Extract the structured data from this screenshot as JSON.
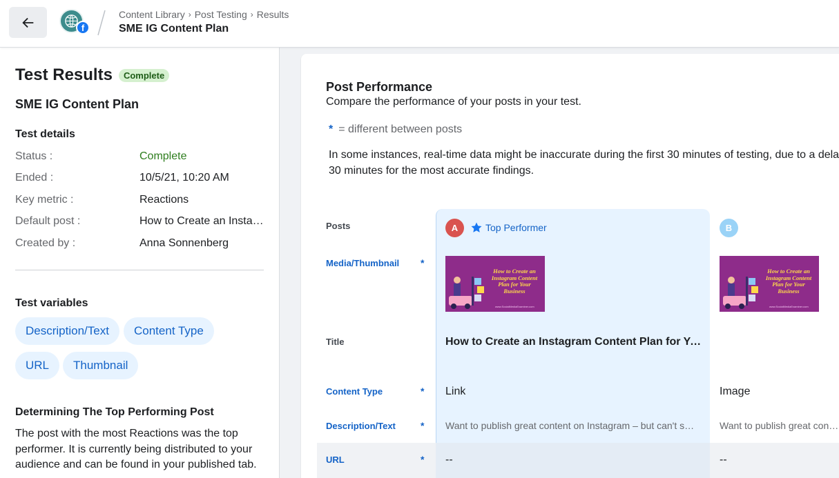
{
  "header": {
    "breadcrumbs": [
      "Content Library",
      "Post Testing",
      "Results"
    ],
    "title": "SME IG Content Plan"
  },
  "left": {
    "heading": "Test Results",
    "status_badge": "Complete",
    "plan_name": "SME IG Content Plan",
    "details_heading": "Test details",
    "details": [
      {
        "key": "Status",
        "value": "Complete"
      },
      {
        "key": "Ended",
        "value": "10/5/21, 10:20 AM"
      },
      {
        "key": "Key metric",
        "value": "Reactions"
      },
      {
        "key": "Default post",
        "value": "How to Create an Instagram Content Plan for Your Business"
      },
      {
        "key": "Created by",
        "value": "Anna Sonnenberg"
      }
    ],
    "variables_heading": "Test variables",
    "variables": [
      "Description/Text",
      "Content Type",
      "URL",
      "Thumbnail"
    ],
    "explain_heading": "Determining The Top Performing Post",
    "explain_text": "The post with the most Reactions was the top performer. It is currently being distributed to your audience and can be found in your published tab."
  },
  "main": {
    "title": "Post Performance",
    "subtitle": "Compare the performance of your posts in your test.",
    "legend_star": "*",
    "legend_text": "= different between posts",
    "note_line1": "In some instances, real-time data might be inaccurate during the first 30 minutes of testing, due to a delay",
    "note_line2": "30 minutes for the most accurate findings.",
    "row_labels": {
      "posts": "Posts",
      "media": "Media/Thumbnail",
      "title": "Title",
      "content_type": "Content Type",
      "description": "Description/Text",
      "url": "URL"
    },
    "star": "*",
    "top_performer": "Top Performer",
    "thumbnail_text": "How to Create an Instagram Content Plan for Your Business",
    "thumbnail_url": "www.SocialMediaExaminer.com",
    "posts": [
      {
        "letter": "A",
        "title": "How to Create an Instagram Content Plan for Your Business",
        "content_type": "Link",
        "description": "Want to publish great content on Instagram – but can't seem to find the time?",
        "url": "--"
      },
      {
        "letter": "B",
        "title": "",
        "content_type": "Image",
        "description": "Want to publish great content on Instagram – but can't seem to find the time?",
        "url": "--"
      }
    ]
  }
}
